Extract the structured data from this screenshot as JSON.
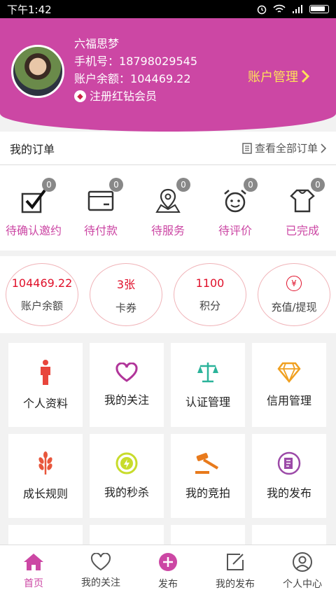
{
  "status": {
    "time": "下午1:42"
  },
  "profile": {
    "name": "六福思梦",
    "phone_label": "手机号：",
    "phone": "18798029545",
    "balance_label": "账户余额：",
    "balance": "104469.22",
    "vip_text": "注册红钻会员",
    "account_mgmt": "账户管理"
  },
  "orders": {
    "title": "我的订单",
    "view_all": "查看全部订单",
    "statuses": [
      {
        "label": "待确认邀约",
        "count": "0",
        "icon": "checkbox-icon"
      },
      {
        "label": "待付款",
        "count": "0",
        "icon": "wallet-icon"
      },
      {
        "label": "待服务",
        "count": "0",
        "icon": "map-pin-icon"
      },
      {
        "label": "待评价",
        "count": "0",
        "icon": "alarm-face-icon"
      },
      {
        "label": "已完成",
        "count": "0",
        "icon": "shirt-icon"
      }
    ]
  },
  "wallet": [
    {
      "value": "104469.22",
      "label": "账户余额"
    },
    {
      "value": "3张",
      "label": "卡券"
    },
    {
      "value": "1100",
      "label": "积分"
    },
    {
      "value": "¥",
      "label": "充值/提现"
    }
  ],
  "grid": [
    {
      "label": "个人资料",
      "icon": "person-icon",
      "color": "#e8453c"
    },
    {
      "label": "我的关注",
      "icon": "heart-icon",
      "color": "#b1359a"
    },
    {
      "label": "认证管理",
      "icon": "scale-icon",
      "color": "#2bb39a"
    },
    {
      "label": "信用管理",
      "icon": "diamond-icon",
      "color": "#f0a020"
    },
    {
      "label": "成长规则",
      "icon": "wheat-icon",
      "color": "#e8563c"
    },
    {
      "label": "我的秒杀",
      "icon": "flash-sale-icon",
      "color": "#c8dc2c"
    },
    {
      "label": "我的竞拍",
      "icon": "gavel-icon",
      "color": "#e87a1c"
    },
    {
      "label": "我的发布",
      "icon": "publish-icon",
      "color": "#9c4aa8"
    }
  ],
  "tabs": [
    {
      "label": "首页",
      "icon": "home-icon",
      "active": true
    },
    {
      "label": "我的关注",
      "icon": "heart-outline-icon"
    },
    {
      "label": "发布",
      "icon": "plus-circle-icon"
    },
    {
      "label": "我的发布",
      "icon": "edit-icon"
    },
    {
      "label": "个人中心",
      "icon": "user-icon"
    }
  ],
  "colors": {
    "brand": "#cc47a4",
    "account_mgmt": "#ffe15a",
    "wallet_value": "#e0102a"
  }
}
